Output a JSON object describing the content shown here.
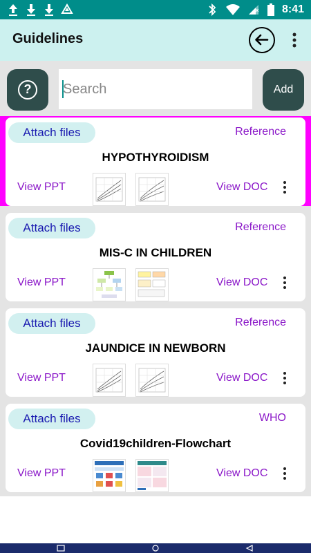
{
  "status_bar": {
    "time": "8:41"
  },
  "app_bar": {
    "title": "Guidelines"
  },
  "search": {
    "placeholder": "Search"
  },
  "add_button": {
    "label": "Add"
  },
  "help_button": {
    "symbol": "?"
  },
  "cards": [
    {
      "attach_label": "Attach files",
      "source": "Reference",
      "title": "HYPOTHYROIDISM",
      "view_ppt": "View PPT",
      "view_doc": "View DOC"
    },
    {
      "attach_label": "Attach files",
      "source": "Reference",
      "title": "MIS-C IN CHILDREN",
      "view_ppt": "View PPT",
      "view_doc": "View DOC"
    },
    {
      "attach_label": "Attach files",
      "source": "Reference",
      "title": "JAUNDICE IN NEWBORN",
      "view_ppt": "View PPT",
      "view_doc": "View DOC"
    },
    {
      "attach_label": "Attach files",
      "source": "WHO",
      "title": "Covid19children-Flowchart",
      "view_ppt": "View PPT",
      "view_doc": "View DOC"
    }
  ],
  "colors": {
    "status_bar": "#008d8a",
    "app_bar": "#ccf1ef",
    "dark_button": "#2f4d4b",
    "selected_card": "#ff00ff",
    "link": "#8a16c8",
    "attach_text": "#1a1ab0"
  }
}
